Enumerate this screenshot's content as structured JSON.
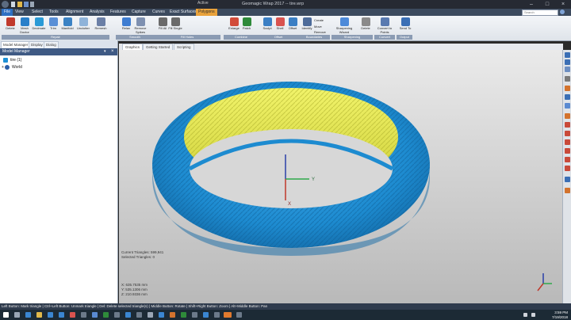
{
  "window": {
    "title": "Geomagic Wrap 2017 -- tire.wrp",
    "context_label": "Active",
    "controls": [
      "minimize-icon",
      "maximize-icon",
      "close-icon"
    ]
  },
  "menu": {
    "tabs": [
      "File",
      "View",
      "Select",
      "Tools",
      "Alignment",
      "Analysis",
      "Features",
      "Capture",
      "Curves",
      "Exact Surfaces",
      "Polygons"
    ],
    "active_tab": "Polygons",
    "search_placeholder": "Search"
  },
  "ribbon": {
    "buttons": [
      {
        "label": "Delete",
        "icon": "delete-icon",
        "color": "#c0392b"
      },
      {
        "label": "Mesh Doctor",
        "icon": "mesh-doctor-icon",
        "color": "#2a7fc9"
      },
      {
        "label": "Decimate",
        "icon": "decimate-icon",
        "color": "#2a9ad6"
      },
      {
        "label": "Trim",
        "icon": "trim-icon",
        "color": "#5a8fd6"
      },
      {
        "label": "Manifold",
        "icon": "manifold-icon",
        "color": "#3b82c4"
      },
      {
        "label": "Unclutter",
        "icon": "unclutter-icon",
        "color": "#8fb3d9"
      },
      {
        "label": "Remesh",
        "icon": "remesh-icon",
        "color": "#6b7fa6"
      },
      {
        "label": "Relax",
        "icon": "relax-icon",
        "color": "#3f7dd1"
      },
      {
        "label": "Remove Spikes",
        "icon": "remove-spikes-icon",
        "color": "#7e90b0"
      },
      {
        "label": "Fill All",
        "icon": "fill-all-icon",
        "color": "#6a6a6a"
      },
      {
        "label": "Fill Single",
        "icon": "fill-single-icon",
        "color": "#6a6a6a"
      },
      {
        "label": "Enlarge",
        "icon": "enlarge-icon",
        "color": "#d24c3a"
      },
      {
        "label": "Patch",
        "icon": "patch-icon",
        "color": "#2f8a3a"
      },
      {
        "label": "Sculpt",
        "icon": "sculpt-icon",
        "color": "#3b7fc4"
      },
      {
        "label": "Shell",
        "icon": "shell-icon",
        "color": "#d9534f"
      },
      {
        "label": "Offset",
        "icon": "offset-icon",
        "color": "#3b7fc4"
      },
      {
        "label": "Identify",
        "icon": "identify-icon",
        "color": "#4d6b99"
      },
      {
        "label": "Sharpening Wizard",
        "icon": "sharpening-wizard-icon",
        "color": "#4d8ad9"
      },
      {
        "label": "Delete",
        "icon": "delete-feature-icon",
        "color": "#8a8a8a"
      },
      {
        "label": "Convert to Points",
        "icon": "convert-to-points-icon",
        "color": "#5a7ab0"
      },
      {
        "label": "Send To",
        "icon": "send-to-icon",
        "color": "#3b6fb5"
      }
    ],
    "small_items": [
      "Create",
      "Move",
      "Remove"
    ],
    "groups": [
      "Repair",
      "Smooth",
      "Fill Holes",
      "Combine",
      "Offset",
      "Boundaries",
      "Sharpening",
      "Convert",
      "Output"
    ]
  },
  "left_panel": {
    "tabs": [
      "Model Manager",
      "Display",
      "Dialog"
    ],
    "header": "Model Manager",
    "tree": [
      {
        "label": "tire (1)",
        "icon": "mesh-icon"
      },
      {
        "label": "World",
        "icon": "globe-icon"
      }
    ]
  },
  "graphics": {
    "tabs": [
      "Graphics",
      "Getting Started",
      "Scripting"
    ],
    "axis_labels": {
      "x": "X",
      "y": "Y"
    },
    "stats": [
      "Current Triangles: 599,941",
      "Selected Triangles: 0"
    ],
    "coords": [
      "X: 635.7535 mm",
      "Y: 535.1306 mm",
      "Z: 210.9336 mm"
    ],
    "colors": {
      "tire": "#1e90d6",
      "inner": "#e6e84a"
    }
  },
  "status_bar": {
    "text": "Left Button: Mark triangle | Ctrl+Left Button: Unmark triangle | Del: Delete selected triangle(s) | Middle Button: Rotate | Shift+Right Button: Zoom | Alt+Middle Button: Pan"
  },
  "taskbar": {
    "time": "3:59 PM",
    "date": "7/19/2018"
  }
}
